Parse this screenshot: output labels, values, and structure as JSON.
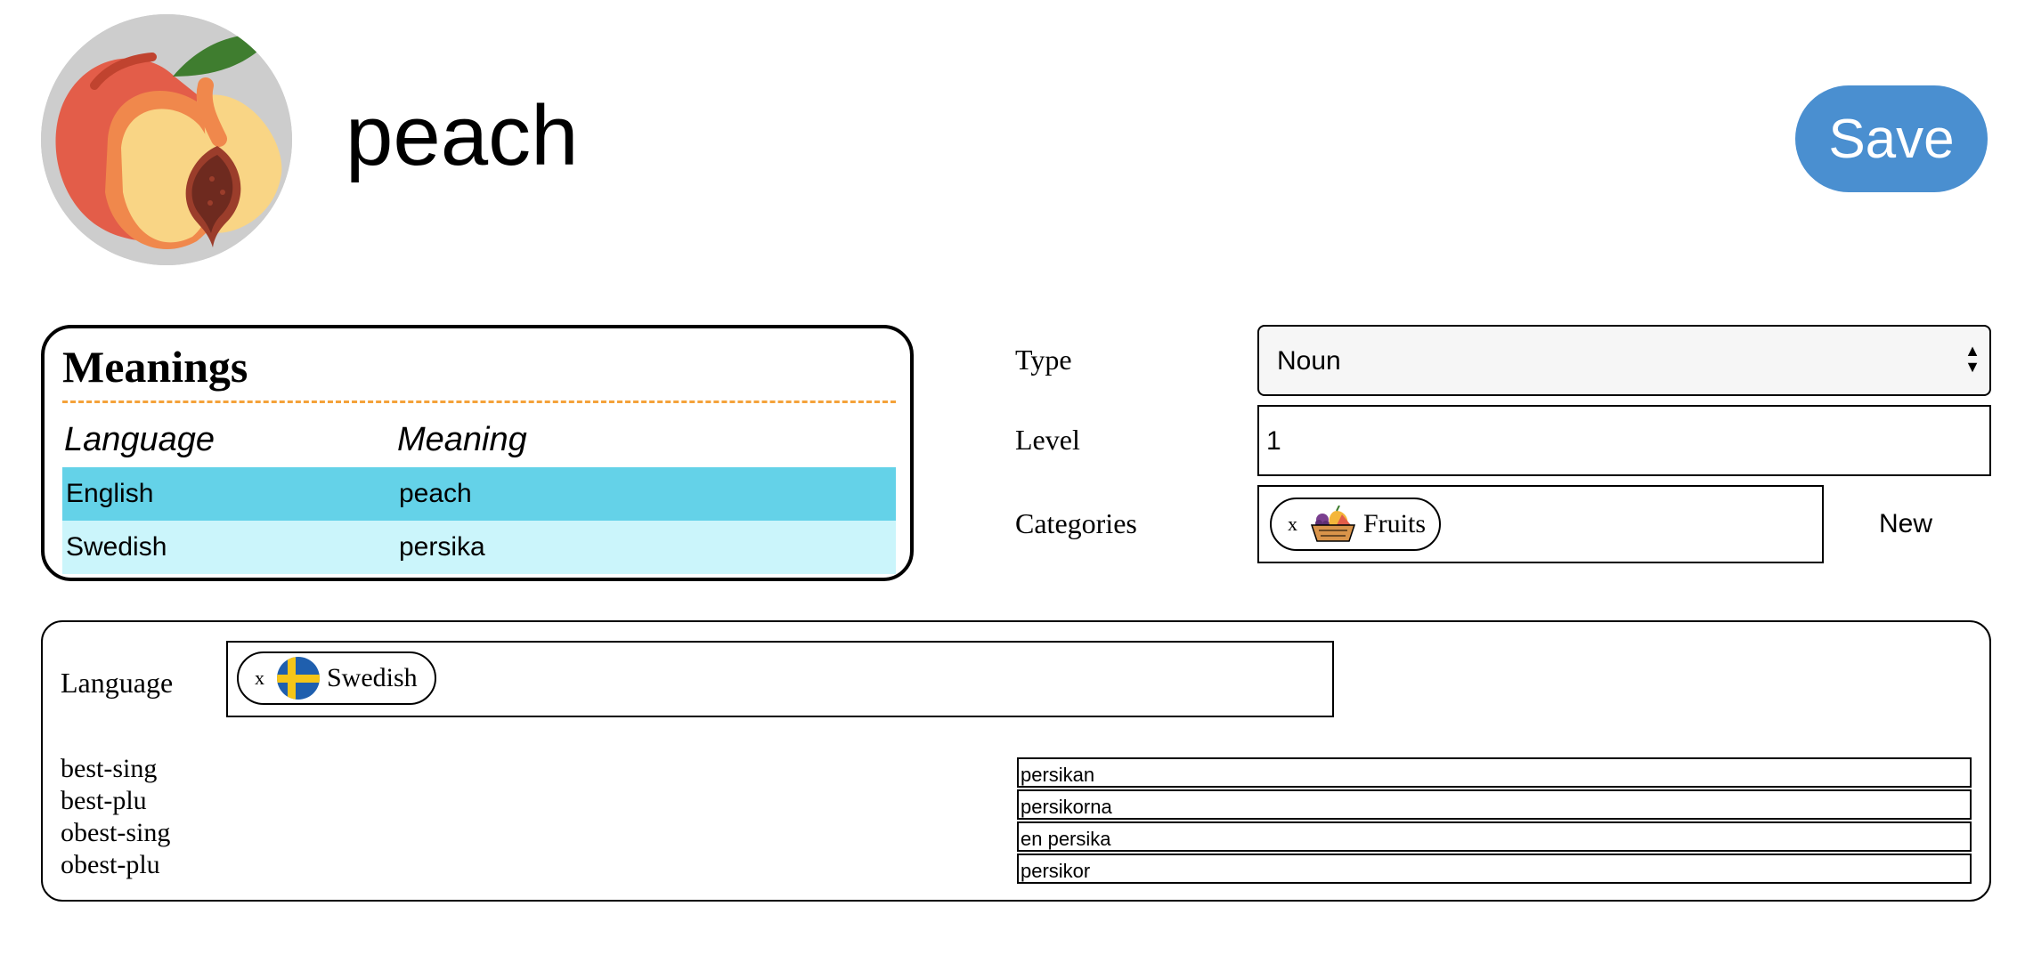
{
  "header": {
    "word": "peach",
    "save_label": "Save",
    "image_icon": "peach-fruit-icon"
  },
  "meanings": {
    "title": "Meanings",
    "columns": [
      "Language",
      "Meaning"
    ],
    "rows": [
      {
        "language": "English",
        "meaning": "peach"
      },
      {
        "language": "Swedish",
        "meaning": "persika"
      }
    ]
  },
  "properties": {
    "type_label": "Type",
    "type_value": "Noun",
    "level_label": "Level",
    "level_value": "1",
    "categories_label": "Categories",
    "categories": [
      {
        "remove": "x",
        "icon": "fruit-basket-icon",
        "label": "Fruits"
      }
    ],
    "new_label": "New"
  },
  "forms": {
    "language_label": "Language",
    "selected_language": {
      "remove": "x",
      "icon": "sweden-flag-icon",
      "label": "Swedish"
    },
    "inflections": [
      {
        "label": "best-sing",
        "value": "persikan"
      },
      {
        "label": "best-plu",
        "value": "persikorna"
      },
      {
        "label": "obest-sing",
        "value": "en persika"
      },
      {
        "label": "obest-plu",
        "value": "persikor"
      }
    ]
  },
  "colors": {
    "save_button": "#4a8fd0",
    "row_highlight": "#64d2e8",
    "row_light": "#cbf5fb",
    "divider": "#f4a23a"
  }
}
